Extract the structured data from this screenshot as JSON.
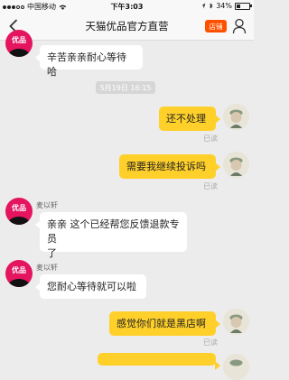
{
  "status_bar": {
    "carrier": "中国移动",
    "time": "下午3:03",
    "battery_percent": "34%",
    "battery_level": 0.34
  },
  "nav": {
    "title": "天猫优品官方直营",
    "shop_label": "店铺"
  },
  "shop": {
    "avatar_text": "优品",
    "brand_color": "#e4145f"
  },
  "accent_color": "#ff5000",
  "timestamp": "5月19日 16:15",
  "messages": [
    {
      "side": "left",
      "text": "辛苦亲亲耐心等待哈"
    },
    {
      "side": "right",
      "text": "还不处理",
      "status": "已读"
    },
    {
      "side": "right",
      "text": "需要我继续投诉吗",
      "status": "已读"
    },
    {
      "side": "left",
      "sender": "麦以轩",
      "line1": "亲亲 这个已经帮您反馈退款专员",
      "line2": "了"
    },
    {
      "side": "left",
      "sender": "麦以轩",
      "text": "您耐心等待就可以啦"
    },
    {
      "side": "right",
      "text": "感觉你们就是黑店啊",
      "status": "已读"
    },
    {
      "side": "right",
      "text": ""
    }
  ]
}
